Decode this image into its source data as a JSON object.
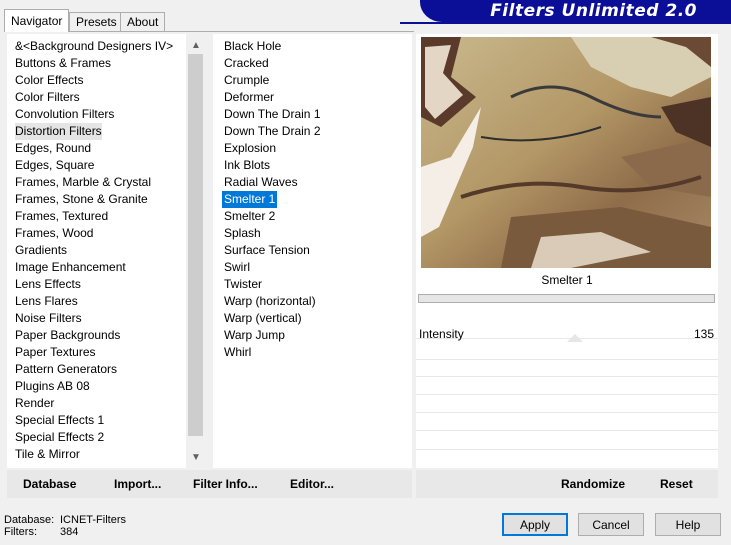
{
  "banner": {
    "title": "Filters Unlimited 2.0"
  },
  "tabs": [
    {
      "label": "Navigator",
      "active": true
    },
    {
      "label": "Presets",
      "active": false
    },
    {
      "label": "About",
      "active": false
    }
  ],
  "categories": {
    "selected": "Distortion Filters",
    "items": [
      "&<Background Designers IV>",
      "Buttons & Frames",
      "Color Effects",
      "Color Filters",
      "Convolution Filters",
      "Distortion Filters",
      "Edges, Round",
      "Edges, Square",
      "Frames, Marble & Crystal",
      "Frames, Stone & Granite",
      "Frames, Textured",
      "Frames, Wood",
      "Gradients",
      "Image Enhancement",
      "Lens Effects",
      "Lens Flares",
      "Noise Filters",
      "Paper Backgrounds",
      "Paper Textures",
      "Pattern Generators",
      "Plugins AB 08",
      "Render",
      "Special Effects 1",
      "Special Effects 2",
      "Tile & Mirror"
    ]
  },
  "filters": {
    "selected": "Smelter 1",
    "items": [
      "Black Hole",
      "Cracked",
      "Crumple",
      "Deformer",
      "Down The Drain 1",
      "Down The Drain 2",
      "Explosion",
      "Ink Blots",
      "Radial Waves",
      "Smelter 1",
      "Smelter 2",
      "Splash",
      "Surface Tension",
      "Swirl",
      "Twister",
      "Warp (horizontal)",
      "Warp (vertical)",
      "Warp Jump",
      "Whirl"
    ]
  },
  "preview": {
    "filter_name": "Smelter 1",
    "params": [
      {
        "label": "Intensity",
        "value": "135"
      }
    ]
  },
  "toolbar": {
    "database": "Database",
    "import": "Import...",
    "filter_info": "Filter Info...",
    "editor": "Editor...",
    "randomize": "Randomize",
    "reset": "Reset"
  },
  "footer": {
    "database_label": "Database:",
    "database_value": "ICNET-Filters",
    "filters_label": "Filters:",
    "filters_value": "384"
  },
  "buttons": {
    "apply": "Apply",
    "cancel": "Cancel",
    "help": "Help"
  },
  "colors": {
    "banner": "#0b0e97",
    "selection": "#0078d7"
  }
}
